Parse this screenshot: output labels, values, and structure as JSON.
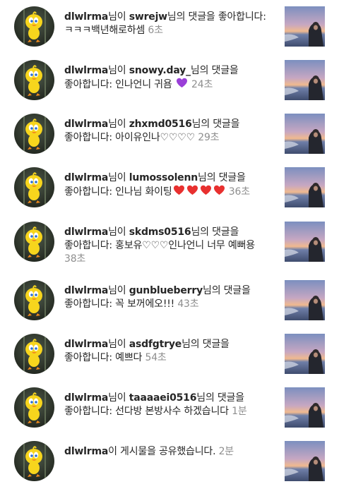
{
  "notifications": [
    {
      "actor": "dlwlrma",
      "verb_1": "님이 ",
      "target": "swrejw",
      "verb_2": "님의 댓글을 좋아합니다: ",
      "comment": "ㅋㅋㅋ백년해로하셈",
      "hearts": [],
      "comment_tail": "",
      "time": "6초"
    },
    {
      "actor": "dlwlrma",
      "verb_1": "님이 ",
      "target": "snowy.day_",
      "verb_2": "님의 댓글을 좋아합니다: ",
      "comment": "인나언니 귀욤 ",
      "hearts": [
        "purple"
      ],
      "comment_tail": "",
      "time": "24초"
    },
    {
      "actor": "dlwlrma",
      "verb_1": "님이 ",
      "target": "zhxmd0516",
      "verb_2": "님의 댓글을 좋아합니다: ",
      "comment": "아이유인나♡♡♡♡",
      "hearts": [],
      "comment_tail": "",
      "time": "29초"
    },
    {
      "actor": "dlwlrma",
      "verb_1": "님이 ",
      "target": "lumossolenn",
      "verb_2": "님의 댓글을 좋아합니다: ",
      "comment": "인나님 화이팅",
      "hearts": [
        "red",
        "red",
        "red",
        "red"
      ],
      "comment_tail": "",
      "time": "36초"
    },
    {
      "actor": "dlwlrma",
      "verb_1": "님이 ",
      "target": "skdms0516",
      "verb_2": "님의 댓글을 좋아합니다: ",
      "comment": "홍보유♡♡♡인나언니 너무 예뻐용",
      "hearts": [],
      "comment_tail": "",
      "time": "38초"
    },
    {
      "actor": "dlwlrma",
      "verb_1": "님이 ",
      "target": "gunblueberry",
      "verb_2": "님의 댓글을 좋아합니다: ",
      "comment": "꼭 보꺼에오!!!",
      "hearts": [],
      "comment_tail": "",
      "time": "43초"
    },
    {
      "actor": "dlwlrma",
      "verb_1": "님이 ",
      "target": "asdfgtrye",
      "verb_2": "님의 댓글을 좋아합니다: ",
      "comment": "예쁘다",
      "hearts": [],
      "comment_tail": "",
      "time": "54초"
    },
    {
      "actor": "dlwlrma",
      "verb_1": "님이 ",
      "target": "taaaaei0516",
      "verb_2": "님의 댓글을 좋아합니다: ",
      "comment": "선다방 본방사수 하겠습니다",
      "hearts": [],
      "comment_tail": "",
      "time": "1분"
    },
    {
      "actor": "dlwlrma",
      "verb_1": "이 게시물을 공유했습니다.",
      "target": "",
      "verb_2": "",
      "comment": "",
      "hearts": [],
      "comment_tail": "",
      "time": "2분"
    }
  ],
  "colors": {
    "heart_red": "#e8302f",
    "heart_purple": "#9a3fd8",
    "time_gray": "#8e8e8e",
    "text": "#262626"
  },
  "icons": {
    "avatar": "tweety-bird-avatar",
    "thumbnail": "sunset-beach-photo"
  }
}
